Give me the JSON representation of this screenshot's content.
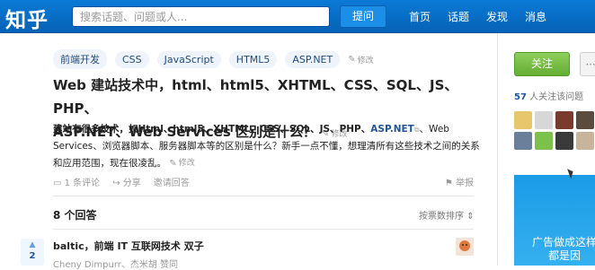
{
  "header": {
    "logo": "知乎",
    "search_placeholder": "搜索话题、问题或人...",
    "ask_button": "提问",
    "nav": [
      "首页",
      "话题",
      "发现",
      "消息"
    ]
  },
  "question": {
    "tags": [
      "前端开发",
      "CSS",
      "JavaScript",
      "HTML5",
      "ASP.NET"
    ],
    "edit_label": "修改",
    "title_line1": "Web 建站技术中，html、html5、XHTML、CSS、SQL、JS、PHP、",
    "title_line2": "ASP.NET、Web Services 区别是什么？",
    "detail_bold": "建站有很多技术，如Html、html5、XHTML、CSS、SQL、JS、PHP、",
    "detail_link": "ASP.NET",
    "detail_rest": "、Web Services、浏览器脚本、服务器脚本等的区别是什么？新手一点不懂，想理清所有这些技术之间的关系和应用范围，现在很凌乱。",
    "actions": {
      "comments": "1 条评论",
      "share": "分享",
      "invite": "邀请回答",
      "report": "举报"
    }
  },
  "answers": {
    "count_label": "8 个回答",
    "sort_label": "按票数排序",
    "first": {
      "votes": "2",
      "author": "baltic，前端 IT 互联网技术 双子",
      "voters": "Cheny Dimpurr、杰米胡 赞同"
    }
  },
  "sidebar": {
    "follow_button": "关注",
    "more_button": "⋯",
    "followers_count": "57",
    "followers_text": " 人关注该问题",
    "ad_text_line1": "广告做成这样",
    "ad_text_line2": "都是因"
  },
  "colors": {
    "brand_blue": "#0767c0",
    "follow_green": "#6ab23b",
    "link_blue": "#225599"
  }
}
